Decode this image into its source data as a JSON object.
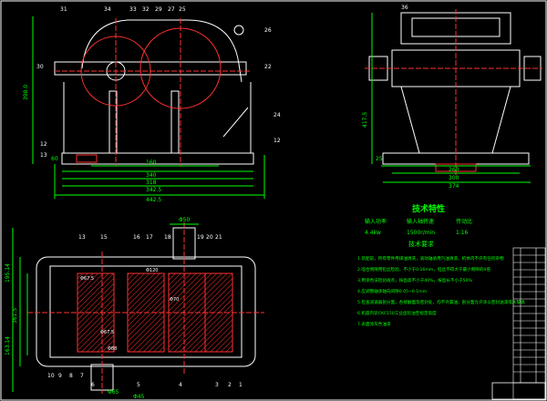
{
  "front_view": {
    "top_labels": [
      "31",
      "34",
      "33",
      "32",
      "29",
      "27",
      "25"
    ],
    "right_labels": [
      "26",
      "22",
      "24",
      "12"
    ],
    "left_labels": [
      "30",
      "12",
      "13"
    ],
    "dim_height": "398.0",
    "dim_left_small": "60",
    "dims_bottom": [
      "160",
      "340",
      "318",
      "342.5",
      "442.5"
    ]
  },
  "side_view": {
    "top_label": "36",
    "dim_height": "417.5",
    "dim_small": "25",
    "dims_bottom": [
      "260",
      "300",
      "374"
    ]
  },
  "plan_view": {
    "top_dim": "Φ50",
    "top_labels": [
      "13",
      "15",
      "16",
      "17",
      "18",
      "19",
      "20",
      "21"
    ],
    "bottom_labels": [
      "10",
      "9",
      "8",
      "7",
      "6",
      "5",
      "4",
      "3",
      "2",
      "1"
    ],
    "left_dims": [
      "195.14",
      "361.5",
      "163.14"
    ],
    "bottom_dims": [
      "Φ65",
      "Φ45"
    ],
    "center_labels": [
      "Φ67.5",
      "Φ67.5",
      "Φ120",
      "Φ70",
      "Φ88"
    ]
  },
  "tech": {
    "title": "技术特性",
    "headers": [
      "输入功率",
      "输入轴转速",
      "传动比"
    ],
    "values": [
      "4.4kw",
      "1500r/min",
      "1.16"
    ],
    "req_title": "技术要求",
    "requirements": [
      "1.装配前，所有零件用煤油清洗，滚动轴承用汽油清洗，机体内不许有任何杂物",
      "2.啮合侧隙用铅丝检验，不小于0.16mm，铅丝不得大于最小侧隙的4倍",
      "3.用涂色法检验斑点，按齿高不小于40%，按齿长不小于50%",
      "4.应调整轴承轴向间隙0.05~0.1mm",
      "5.检查减速器剖分面，各接触面及密封处，均不许漏油，剖分面允许涂以密封油漆或水玻璃",
      "6.机座内装CKC150工业齿轮油至规定高度",
      "7.表面涂灰色油漆"
    ]
  }
}
